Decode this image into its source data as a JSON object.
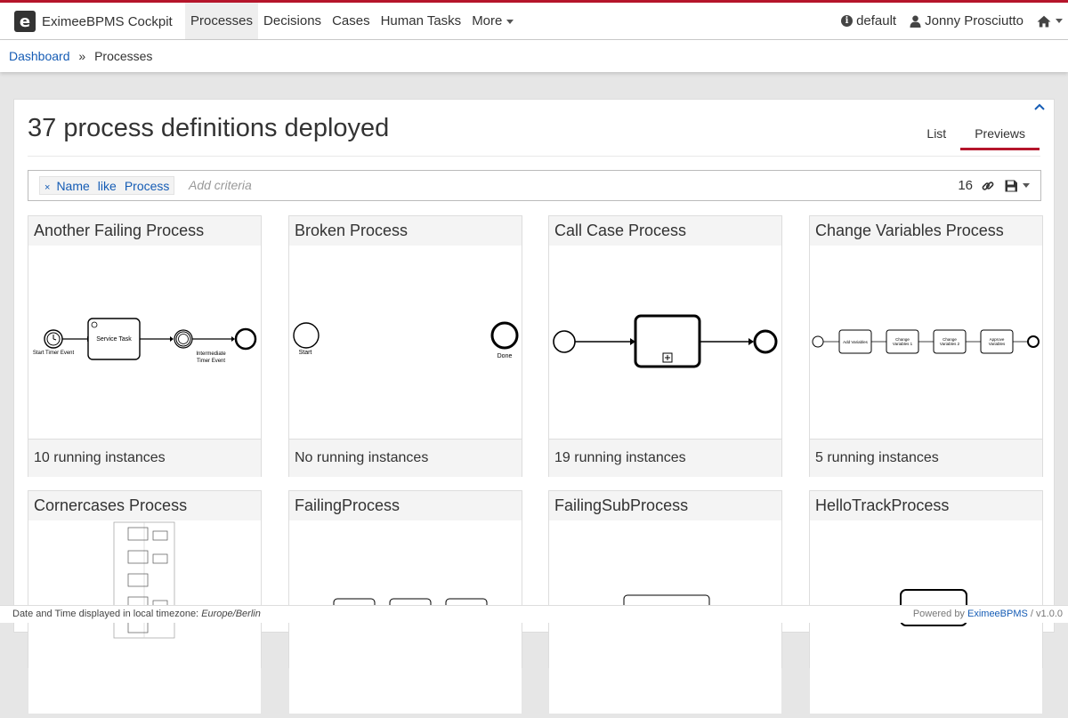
{
  "app": {
    "brand_letter": "e",
    "brand_name": "EximeeBPMS Cockpit"
  },
  "nav": {
    "items": [
      "Processes",
      "Decisions",
      "Cases",
      "Human Tasks",
      "More"
    ],
    "active": "Processes",
    "engine": "default",
    "user": "Jonny Prosciutto"
  },
  "breadcrumb": {
    "home": "Dashboard",
    "separator": "»",
    "current": "Processes"
  },
  "main": {
    "title": "37 process definitions deployed",
    "tabs": {
      "list": "List",
      "previews": "Previews"
    },
    "active_tab": "Previews"
  },
  "search": {
    "chip": {
      "remove": "×",
      "key": "Name",
      "operator": "like",
      "value": "Process"
    },
    "placeholder": "Add criteria",
    "count": "16"
  },
  "cards": [
    {
      "title": "Another Failing Process",
      "footer": "10 running instances",
      "labels": {
        "start": "Start Timer Event",
        "task": "Service Task",
        "intermediate_1": "Intermediate",
        "intermediate_2": "Timer Event"
      }
    },
    {
      "title": "Broken Process",
      "footer": "No running instances",
      "labels": {
        "start": "Start",
        "end": "Done"
      }
    },
    {
      "title": "Call Case Process",
      "footer": "19 running instances",
      "labels": {}
    },
    {
      "title": "Change Variables Process",
      "footer": "5 running instances",
      "labels": {
        "task_1": "Add Variables",
        "task_2a": "Change",
        "task_2b": "Variables 1",
        "task_3a": "Change",
        "task_3b": "Variables 2",
        "task_4a": "Approve",
        "task_4b": "Variables"
      }
    },
    {
      "title": "Cornercases Process",
      "labels": {}
    },
    {
      "title": "FailingProcess",
      "labels": {}
    },
    {
      "title": "FailingSubProcess",
      "labels": {}
    },
    {
      "title": "HelloTrackProcess",
      "labels": {}
    }
  ],
  "status": {
    "left_label": "Date and Time displayed in local timezone:",
    "timezone": "Europe/Berlin",
    "powered_by": "Powered by",
    "product": "EximeeBPMS",
    "version": "/ v1.0.0"
  },
  "colors": {
    "accent": "#b5152b",
    "link": "#155cb5"
  }
}
